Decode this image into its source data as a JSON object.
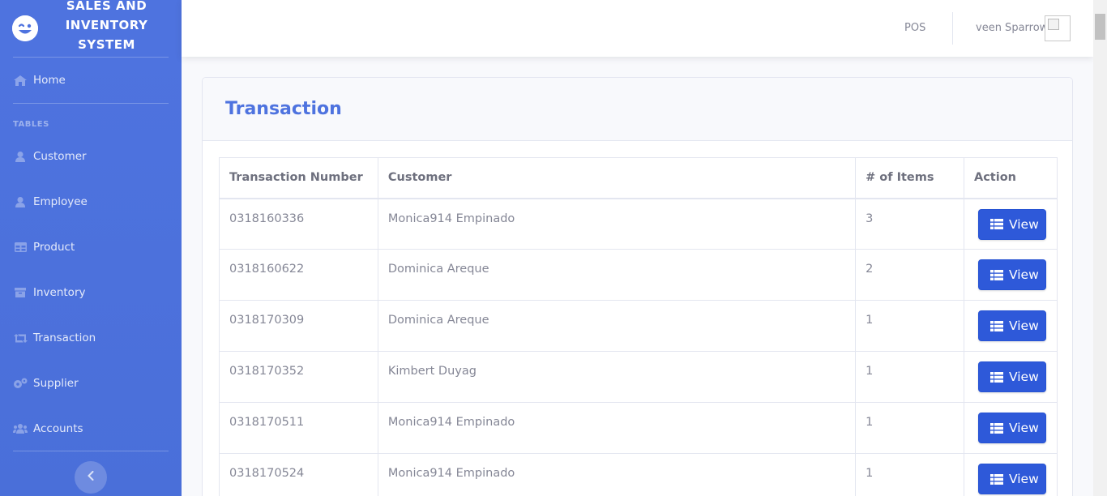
{
  "brand": {
    "title": "SALES AND INVENTORY SYSTEM",
    "icon": "laugh-wink-icon"
  },
  "sidebar": {
    "home": {
      "label": "Home",
      "icon": "home-icon"
    },
    "heading": "TABLES",
    "items": [
      {
        "label": "Customer",
        "icon": "user-icon"
      },
      {
        "label": "Employee",
        "icon": "user-icon"
      },
      {
        "label": "Product",
        "icon": "table-icon"
      },
      {
        "label": "Inventory",
        "icon": "archive-icon"
      },
      {
        "label": "Transaction",
        "icon": "retweet-icon"
      },
      {
        "label": "Supplier",
        "icon": "cogs-icon"
      },
      {
        "label": "Accounts",
        "icon": "users-icon"
      }
    ],
    "toggle_icon": "chevron-left-icon"
  },
  "topbar": {
    "pos_label": "POS",
    "user_name": "veen Sparrow"
  },
  "page": {
    "title": "Transaction"
  },
  "table": {
    "headers": [
      "Transaction Number",
      "Customer",
      "# of Items",
      "Action"
    ],
    "button_label": "View",
    "rows": [
      {
        "number": "0318160336",
        "customer": "Monica914 Empinado",
        "items": "3"
      },
      {
        "number": "0318160622",
        "customer": "Dominica Areque",
        "items": "2"
      },
      {
        "number": "0318170309",
        "customer": "Dominica Areque",
        "items": "1"
      },
      {
        "number": "0318170352",
        "customer": "Kimbert Duyag",
        "items": "1"
      },
      {
        "number": "0318170511",
        "customer": "Monica914 Empinado",
        "items": "1"
      },
      {
        "number": "0318170524",
        "customer": "Monica914 Empinado",
        "items": "1"
      }
    ]
  },
  "colors": {
    "primary": "#4e73df",
    "button": "#2e59d9",
    "text": "#858796"
  }
}
